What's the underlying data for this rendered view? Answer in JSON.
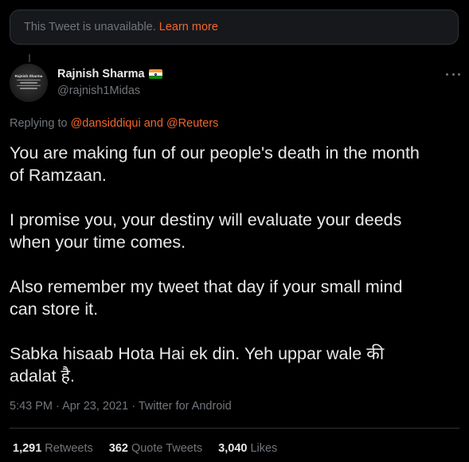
{
  "unavailable": {
    "message": "This Tweet is unavailable.",
    "link": "Learn more"
  },
  "author": {
    "name": "Rajnish Sharma",
    "handle": "@rajnish1Midas",
    "avatar_text": "Rajnish Sharma",
    "badge_icon": "india-flag-icon"
  },
  "reply": {
    "prefix": "Replying to",
    "mention1": "@dansiddiqui",
    "conjunction": "and",
    "mention2": "@Reuters"
  },
  "tweet": {
    "paragraphs": [
      "You are making fun of our people's death in the month\nof Ramzaan.",
      "I promise you, your destiny will evaluate your deeds\nwhen your time comes.",
      "Also remember my tweet that day if your small mind\ncan store it.",
      "Sabka hisaab Hota Hai ek din. Yeh uppar wale की\nadalat है."
    ],
    "time": "5:43 PM",
    "date": "Apr 23, 2021",
    "separator": "·",
    "source": "Twitter for Android"
  },
  "stats": {
    "retweets_count": "1,291",
    "retweets_label": "Retweets",
    "quotes_count": "362",
    "quotes_label": "Quote Tweets",
    "likes_count": "3,040",
    "likes_label": "Likes"
  },
  "colors": {
    "background": "#000000",
    "text": "#e7e9ea",
    "muted": "#71767b",
    "accent": "#f4652b",
    "border": "#2f3336"
  }
}
